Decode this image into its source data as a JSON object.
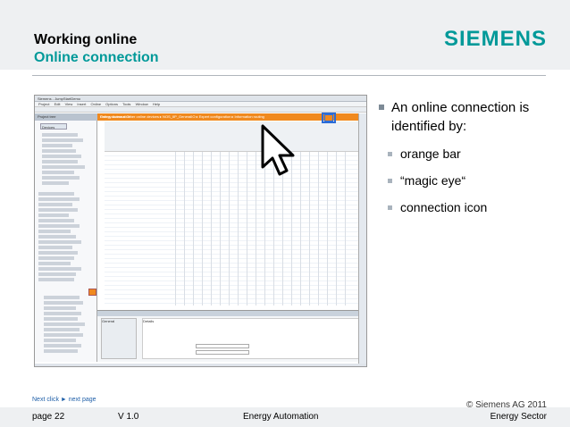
{
  "header": {
    "title": "Working online",
    "subtitle": "Online connection",
    "logo": "SIEMENS"
  },
  "screenshot": {
    "window_title": "Siemens - JumpStartDemo",
    "menu": [
      "Project",
      "Edit",
      "View",
      "Insert",
      "Online",
      "Options",
      "Tools",
      "Window",
      "Help"
    ],
    "orange_bar_text": "Online access  ▸  Other online devices  ▸  NOS_IIP_GeneralIO  ▸  Expert configuration  ▸  Information routing",
    "online_label": "Energy Automation",
    "premium_label": "DIGSI 5 Premium",
    "project_tree": "Project tree",
    "devices_tab": "Devices",
    "properties_tab": "Properties",
    "info_tab": "Info",
    "general_label": "General",
    "details_label": "Details",
    "name_label": "Name:",
    "name_value": "Pickup",
    "original_name_label": "Original name:",
    "original_name_value": "Pickup",
    "overview_tab": "Overview",
    "information_tab": "Information ...",
    "status_text": "The project Jump..."
  },
  "bullets": {
    "main": "An online connection is identified by:",
    "items": [
      "orange bar",
      "“magic eye“",
      "connection icon"
    ]
  },
  "footer": {
    "next_click": "Next click ► next page",
    "copyright": "© Siemens AG 2011",
    "page": "page 22",
    "version": "V 1.0",
    "center": "Energy Automation",
    "sector": "Energy Sector"
  },
  "colors": {
    "accent": "#009999",
    "online_orange": "#f0891e",
    "callout_blue": "#2b6cd6"
  }
}
